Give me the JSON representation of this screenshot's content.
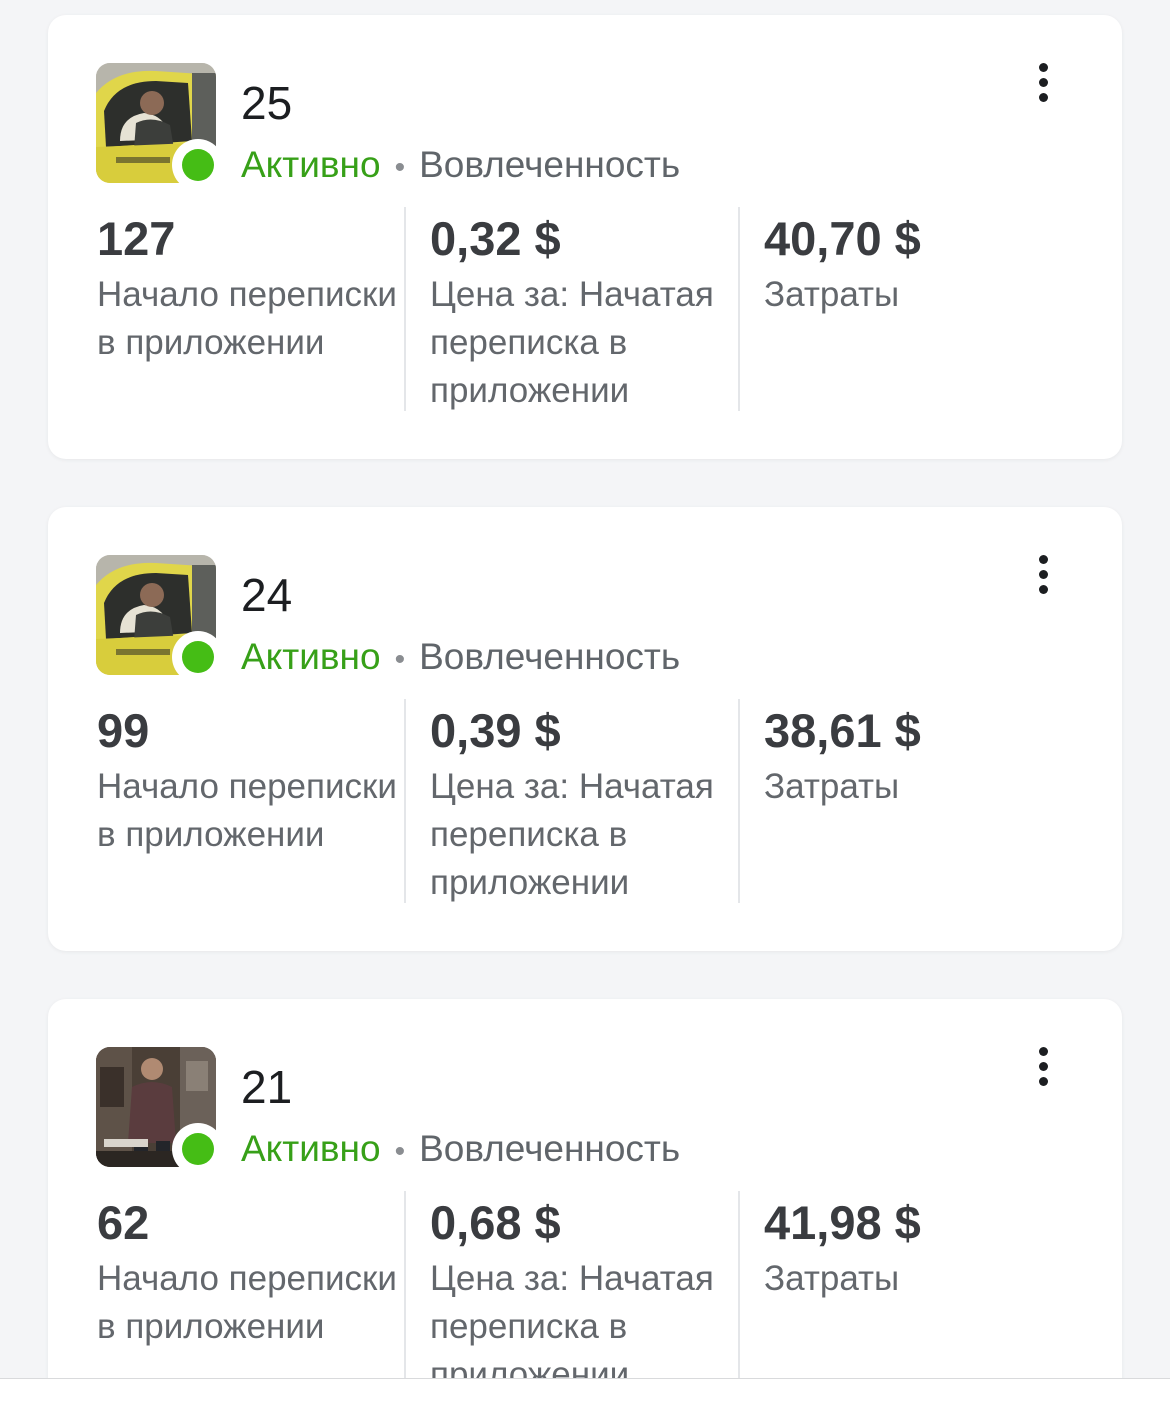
{
  "ads": [
    {
      "name": "25",
      "status": "Активно",
      "objective": "Вовлеченность",
      "thumbnail": "van-driver-thumbnail",
      "metrics": [
        {
          "value": "127",
          "label": "Начало переписки в приложении"
        },
        {
          "value": "0,32 $",
          "label": "Цена за: Начатая переписка в приложении"
        },
        {
          "value": "40,70 $",
          "label": "Затраты"
        }
      ]
    },
    {
      "name": "24",
      "status": "Активно",
      "objective": "Вовлеченность",
      "thumbnail": "van-driver-thumbnail",
      "metrics": [
        {
          "value": "99",
          "label": "Начало переписки в приложении"
        },
        {
          "value": "0,39 $",
          "label": "Цена за: Начатая переписка в приложении"
        },
        {
          "value": "38,61 $",
          "label": "Затраты"
        }
      ]
    },
    {
      "name": "21",
      "status": "Активно",
      "objective": "Вовлеченность",
      "thumbnail": "man-standing-thumbnail",
      "metrics": [
        {
          "value": "62",
          "label": "Начало переписки в приложении"
        },
        {
          "value": "0,68 $",
          "label": "Цена за: Начатая переписка в приложении"
        },
        {
          "value": "41,98 $",
          "label": "Затраты"
        }
      ]
    }
  ],
  "separator": "•",
  "colors": {
    "active_green": "#45bd15",
    "active_text": "#37a018",
    "card_background": "#ffffff",
    "page_background": "#f4f5f7"
  },
  "icons": {
    "menu": "more-vertical-icon",
    "status": "status-dot-icon"
  }
}
